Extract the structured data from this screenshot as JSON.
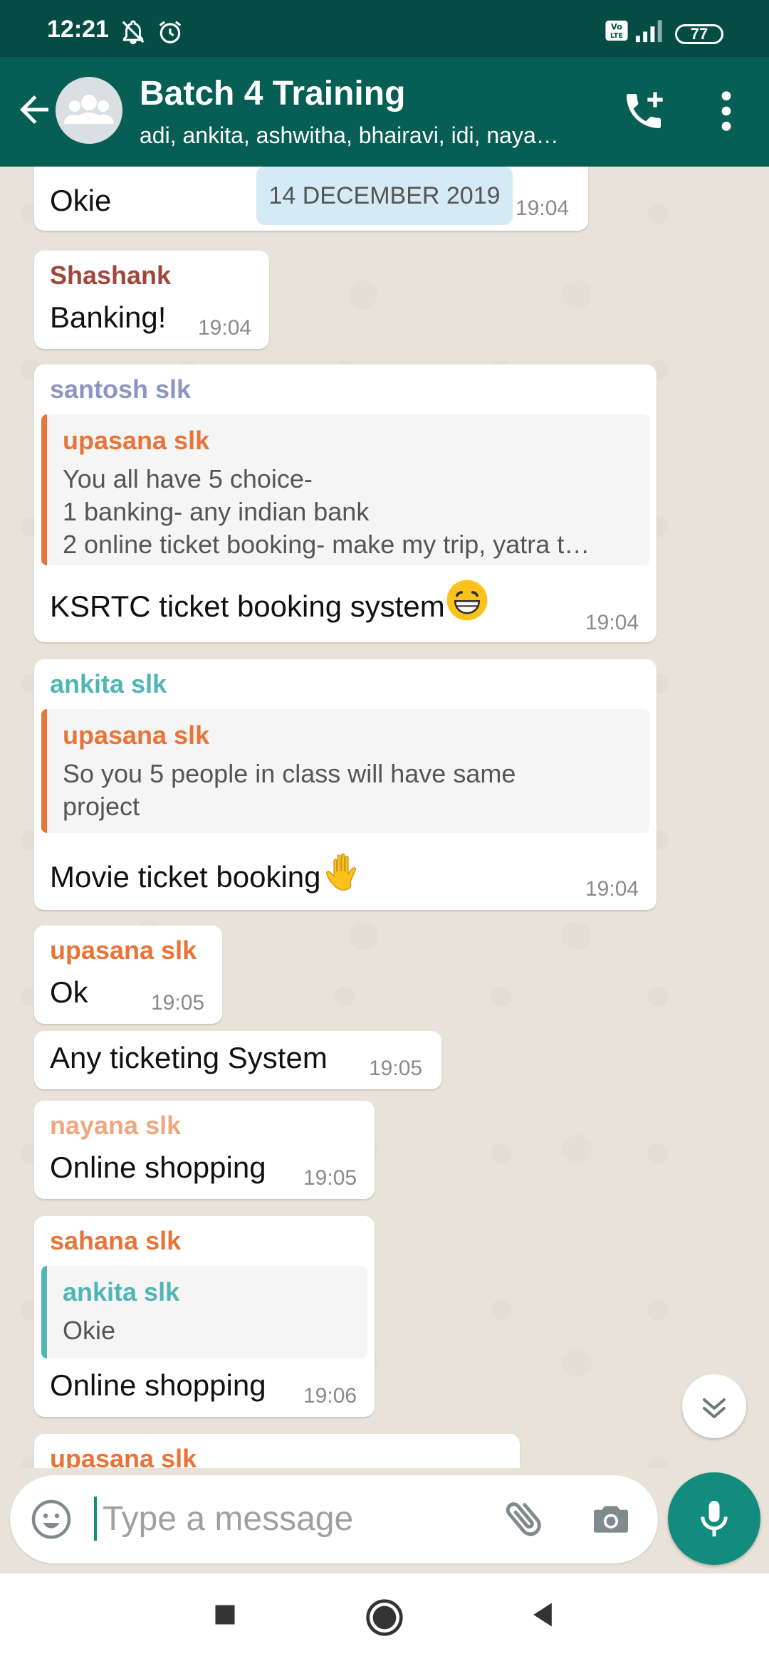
{
  "status_bar": {
    "time": "12:21",
    "battery": "77"
  },
  "header": {
    "title": "Batch 4 Training",
    "subtitle": "adi, ankita, ashwitha, bhairavi, idi, naya…"
  },
  "date_chip": "14 DECEMBER 2019",
  "messages": [
    {
      "text": "Okie",
      "time": "19:04"
    },
    {
      "sender": "Shashank",
      "sender_color": "#a0473a",
      "text": "Banking!",
      "time": "19:04"
    },
    {
      "sender": "santosh slk",
      "sender_color": "#8c95c4",
      "quote": {
        "sender": "upasana slk",
        "color": "#e8743a",
        "lines": [
          "You all have 5 choice-",
          "1 banking- any indian bank",
          "2 online ticket booking- make my trip, yatra t…"
        ]
      },
      "text": "KSRTC ticket booking system",
      "emoji": "grinning-face",
      "time": "19:04"
    },
    {
      "sender": "ankita slk",
      "sender_color": "#4fb5b5",
      "quote": {
        "sender": "upasana slk",
        "color": "#e8743a",
        "lines": [
          "So you 5 people in class will have same",
          "project"
        ]
      },
      "text": "Movie ticket booking",
      "emoji": "raised-hand",
      "time": "19:04"
    },
    {
      "sender": "upasana slk",
      "sender_color": "#e8743a",
      "text": "Ok",
      "time": "19:05"
    },
    {
      "text": "Any ticketing System",
      "time": "19:05"
    },
    {
      "sender": "nayana slk",
      "sender_color": "#f0a67e",
      "text": "Online shopping",
      "time": "19:05"
    },
    {
      "sender": "sahana slk",
      "sender_color": "#e8743a",
      "quote": {
        "sender": "ankita slk",
        "color": "#4fb5b5",
        "lines": [
          "Okie"
        ]
      },
      "text": "Online shopping",
      "time": "19:06"
    },
    {
      "sender": "upasana slk",
      "sender_color": "#e8743a"
    }
  ],
  "input": {
    "placeholder": "Type a message"
  },
  "colors": {
    "status_bar": "#054d44",
    "app_bar": "#075e54",
    "accent": "#128c7e",
    "chat_bg": "#e9e2d8"
  },
  "icons": [
    "back-arrow-icon",
    "group-avatar-icon",
    "add-call-icon",
    "more-vert-icon",
    "emoji-icon",
    "attach-icon",
    "camera-icon",
    "mic-icon",
    "scroll-down-icon"
  ]
}
